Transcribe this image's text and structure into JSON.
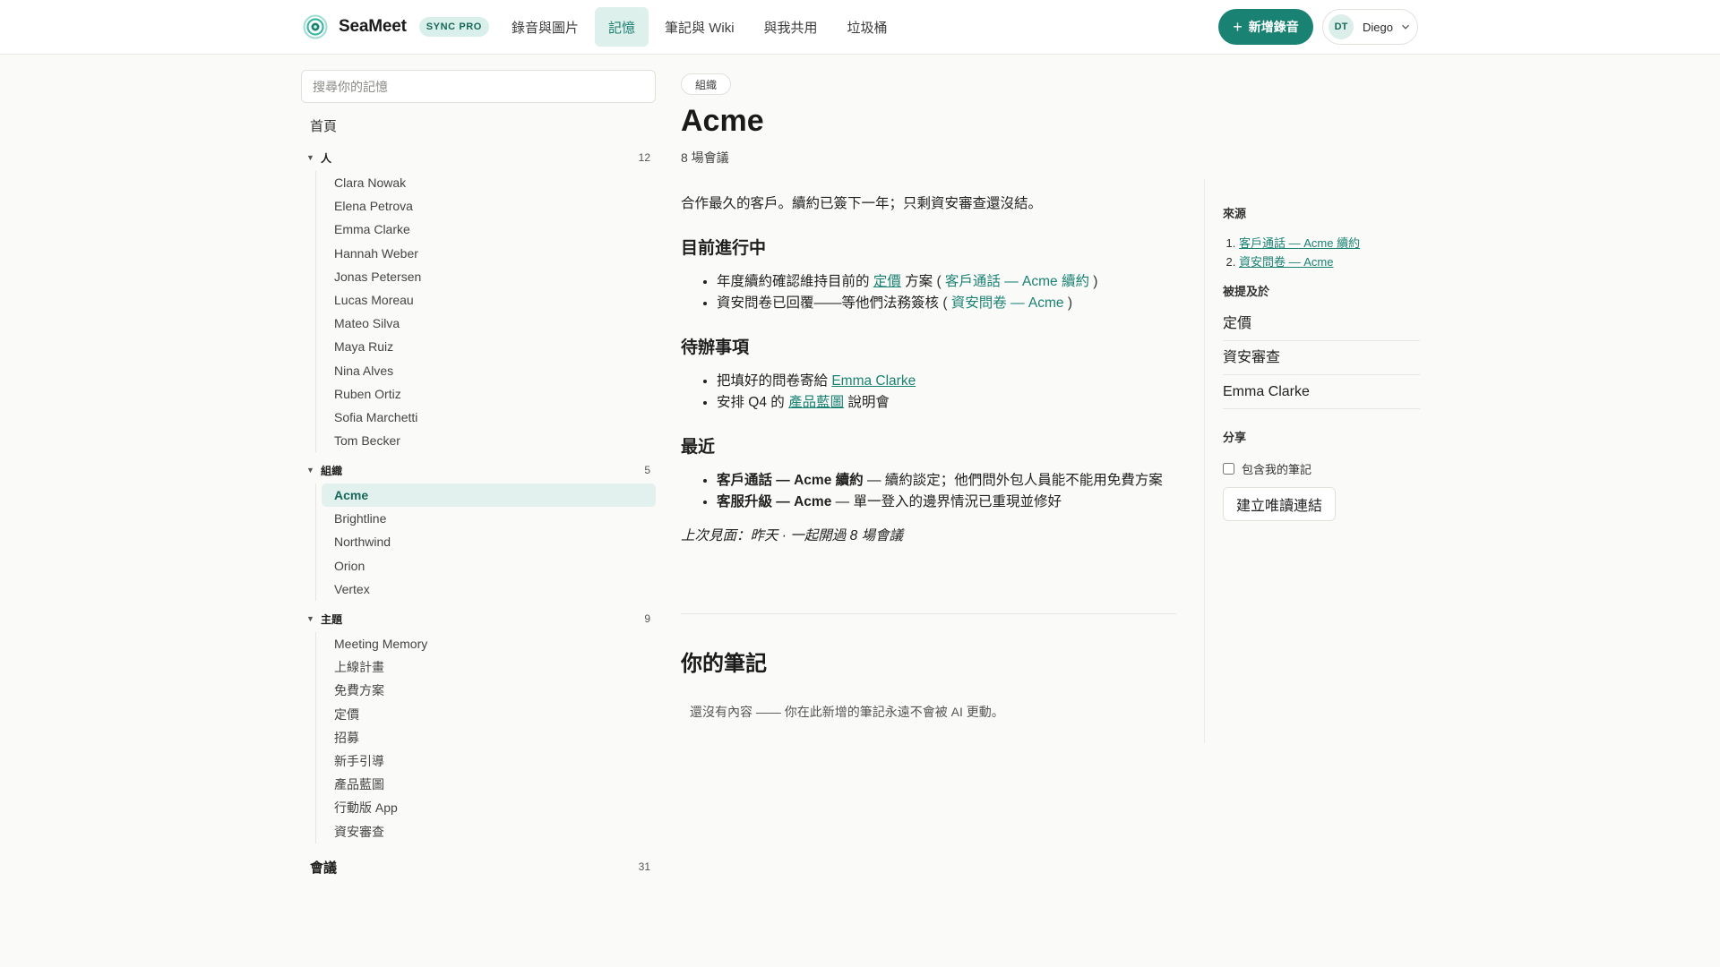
{
  "app": {
    "name": "SeaMeet",
    "badge": "SYNC PRO",
    "logo_icon": "seameet-logo-icon",
    "accent": "#1a8273"
  },
  "nav": {
    "tabs": [
      {
        "label": "錄音與圖片"
      },
      {
        "label": "記憶",
        "active": true
      },
      {
        "label": "筆記與 Wiki"
      },
      {
        "label": "與我共用"
      },
      {
        "label": "垃圾桶"
      }
    ],
    "new_recording_label": "新增錄音",
    "user": {
      "initials": "DT",
      "name": "Diego"
    }
  },
  "sidebar": {
    "search_placeholder": "搜尋你的記憶",
    "home_label": "首頁",
    "groups": {
      "people": {
        "label": "人",
        "count": "12",
        "items": [
          "Clara Nowak",
          "Elena Petrova",
          "Emma Clarke",
          "Hannah Weber",
          "Jonas Petersen",
          "Lucas Moreau",
          "Mateo Silva",
          "Maya Ruiz",
          "Nina Alves",
          "Ruben Ortiz",
          "Sofia Marchetti",
          "Tom Becker"
        ]
      },
      "orgs": {
        "label": "組織",
        "count": "5",
        "items": [
          "Acme",
          "Brightline",
          "Northwind",
          "Orion",
          "Vertex"
        ],
        "active": "Acme"
      },
      "topics": {
        "label": "主題",
        "count": "9",
        "items": [
          "Meeting Memory",
          "上線計畫",
          "免費方案",
          "定價",
          "招募",
          "新手引導",
          "產品藍圖",
          "行動版 App",
          "資安審查"
        ]
      }
    },
    "meetings": {
      "label": "會議",
      "count": "31"
    }
  },
  "page": {
    "type_chip": "組織",
    "title": "Acme",
    "meeting_count": "8 場會議",
    "summary": "合作最久的客戶。續約已簽下一年；只剩資安審查還沒結。",
    "in_progress": {
      "heading": "目前進行中",
      "item1": {
        "before": "年度續約確認維持目前的 ",
        "link1": "定價",
        "middle": " 方案 ",
        "link2": "客戶通話 — Acme 續約"
      },
      "item2": {
        "before": "資安問卷已回覆——等他們法務簽核 ",
        "link": "資安問卷 — Acme"
      }
    },
    "todo": {
      "heading": "待辦事項",
      "item1": {
        "before": "把填好的問卷寄給 ",
        "link": "Emma Clarke"
      },
      "item2": {
        "before": "安排 Q4 的 ",
        "link": "產品藍圖",
        "after": " 說明會"
      }
    },
    "recent": {
      "heading": "最近",
      "item1": {
        "bold": "客戶通話 — Acme 續約",
        "rest": " — 續約談定；他們問外包人員能不能用免費方案"
      },
      "item2": {
        "bold": "客服升級 — Acme",
        "rest": " — 單一登入的邊界情況已重現並修好"
      }
    },
    "last_seen": "上次見面：昨天 · 一起開過 8 場會議",
    "notes": {
      "heading": "你的筆記",
      "empty": "還沒有內容 —— 你在此新增的筆記永遠不會被 AI 更動。"
    }
  },
  "right_panel": {
    "sources_heading": "來源",
    "sources": [
      "客戶通話 — Acme 續約",
      "資安問卷 — Acme"
    ],
    "mentioned_heading": "被提及於",
    "mentions": [
      "定價",
      "資安審查",
      "Emma Clarke"
    ],
    "share_heading": "分享",
    "include_notes_label": "包含我的筆記",
    "create_link_label": "建立唯讀連結"
  }
}
